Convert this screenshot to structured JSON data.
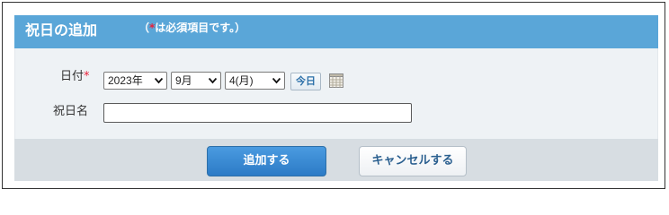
{
  "dialog": {
    "title": "祝日の追加",
    "required_note": {
      "open": "（",
      "asterisk": "*",
      "text": "は必須項目です。）"
    }
  },
  "form": {
    "date": {
      "label": "日付",
      "required_mark": "*",
      "year": "2023年",
      "month": "9月",
      "day": "4(月)",
      "today_button": "今日",
      "calendar_icon": "calendar-icon"
    },
    "holiday_name": {
      "label": "祝日名",
      "value": ""
    }
  },
  "actions": {
    "add_label": "追加する",
    "cancel_label": "キャンセルする"
  },
  "colors": {
    "header_bg": "#5aa6d8",
    "required": "#e8213a",
    "primary_button": "#2c7bc6"
  }
}
